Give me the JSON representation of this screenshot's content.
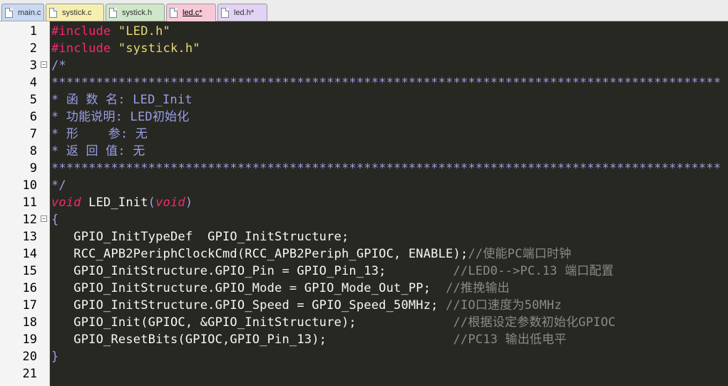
{
  "tabs": [
    {
      "label": "main.c",
      "color": "#c9d9f3"
    },
    {
      "label": "systick.c",
      "color": "#f6efb0"
    },
    {
      "label": "systick.h",
      "color": "#cfe7c8"
    },
    {
      "label": "led.c*",
      "color": "#f7c9d6"
    },
    {
      "label": "led.h*",
      "color": "#e2d2f3"
    }
  ],
  "active_tab": "led.c*",
  "line_numbers": [
    "1",
    "2",
    "3",
    "4",
    "5",
    "6",
    "7",
    "8",
    "9",
    "10",
    "11",
    "12",
    "13",
    "14",
    "15",
    "16",
    "17",
    "18",
    "19",
    "20",
    "21"
  ],
  "code": {
    "l1_kw": "#include",
    "l1_str": "\"LED.h\"",
    "l2_kw": "#include",
    "l2_str": "\"systick.h\"",
    "l3": "/*",
    "stars": "******************************************************************************************",
    "l5": "* 函 数 名: LED_Init",
    "l6": "* 功能说明: LED初始化",
    "l7": "* 形    参: 无",
    "l8": "* 返 回 值: 无",
    "l10": "*/",
    "l11_void1": "void",
    "l11_name": " LED_Init",
    "l11_open": "(",
    "l11_void2": "void",
    "l11_close": ")",
    "l12": "{",
    "l13": "   GPIO_InitTypeDef  GPIO_InitStructure;",
    "l14_code": "   RCC_APB2PeriphClockCmd(RCC_APB2Periph_GPIOC, ENABLE);",
    "l14_cmt": "//使能PC端口时钟",
    "l15_code": "   GPIO_InitStructure.GPIO_Pin = GPIO_Pin_13;         ",
    "l15_cmt": "//LED0-->PC.13 端口配置",
    "l16_code": "   GPIO_InitStructure.GPIO_Mode = GPIO_Mode_Out_PP;  ",
    "l16_cmt": "//推挽输出",
    "l17_code": "   GPIO_InitStructure.GPIO_Speed = GPIO_Speed_50MHz; ",
    "l17_cmt": "//IO口速度为50MHz",
    "l18_code": "   GPIO_Init(GPIOC, &GPIO_InitStructure);             ",
    "l18_cmt": "//根据设定参数初始化GPIOC",
    "l19_code": "   GPIO_ResetBits(GPIOC,GPIO_Pin_13);                 ",
    "l19_cmt": "//PC13 输出低电平",
    "l20": "}"
  }
}
